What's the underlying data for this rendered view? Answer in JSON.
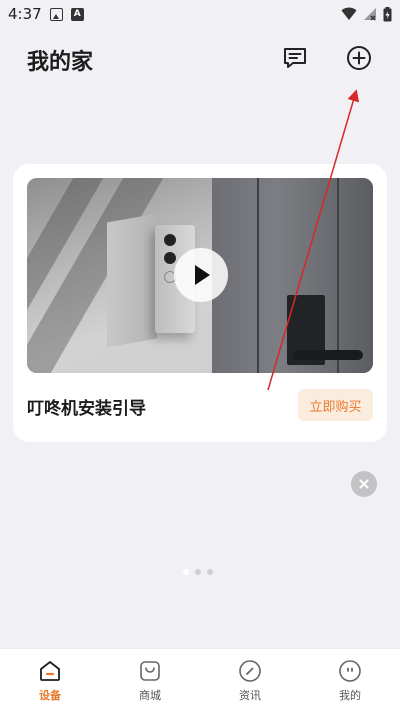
{
  "status_bar": {
    "time": "4:37"
  },
  "header": {
    "title": "我的家",
    "message_icon": "message-icon",
    "add_icon": "add-circle-icon"
  },
  "card": {
    "title": "叮咚机安装引导",
    "buy_label": "立即购买",
    "play_icon": "play-icon"
  },
  "pager": {
    "count": 3,
    "active_index": 0
  },
  "bottom_nav": {
    "items": [
      {
        "label": "设备",
        "icon": "home-icon",
        "active": true
      },
      {
        "label": "商城",
        "icon": "shop-bag-icon",
        "active": false
      },
      {
        "label": "资讯",
        "icon": "compass-icon",
        "active": false
      },
      {
        "label": "我的",
        "icon": "profile-icon",
        "active": false
      }
    ]
  },
  "colors": {
    "accent": "#e8792b",
    "background": "#f1f1f5",
    "annotation_arrow": "#d62828"
  }
}
